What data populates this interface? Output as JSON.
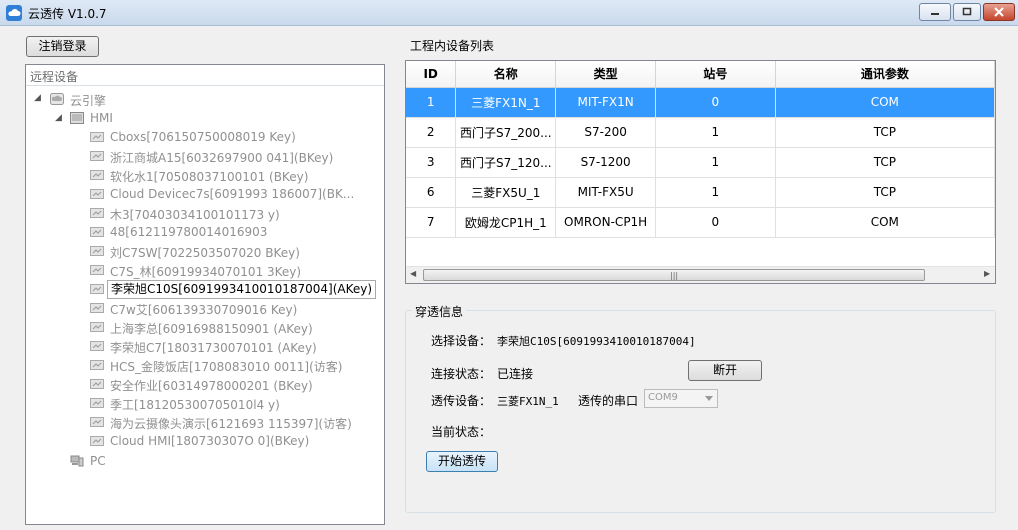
{
  "window": {
    "title": "云透传 V1.0.7"
  },
  "left": {
    "logout_label": "注销登录",
    "panel_header": "远程设备",
    "tree": {
      "root": "云引擎",
      "hmi": "HMI",
      "items": [
        "Cboxs[706150750008019          Key)",
        "浙江商城A15[6032697900         041](BKey)",
        "软化水1[70508037100101         (BKey)",
        "Cloud Devicec7s[6091993        186007](BK...",
        "木3[70403034100101173          y)",
        "48[612119780014016903",
        "刘C7SW[7022503507020           BKey)",
        "C7S_林[60919934070101          3Key)",
        "李荣旭C10S[6091993410010187004](AKey)",
        "C7w艾[606139330709016          Key)",
        "上海李总[60916988150901        (AKey)",
        "李荣旭C7[18031730070101        (AKey)",
        "HCS_金陵饭店[1708083010        0011](访客)",
        "安全作业[60314978000201        (BKey)",
        "季工[181205300705010l4         y)",
        "海为云摄像头演示[6121693       115397](访客)",
        "Cloud HMI[180730307O           0](BKey)"
      ],
      "selected_index": 8,
      "pc": "PC"
    }
  },
  "device_list": {
    "title": "工程内设备列表",
    "columns": [
      "ID",
      "名称",
      "类型",
      "站号",
      "通讯参数"
    ],
    "rows": [
      [
        "1",
        "三菱FX1N_1",
        "MIT-FX1N",
        "0",
        "COM"
      ],
      [
        "2",
        "西门子S7_200...",
        "S7-200",
        "1",
        "TCP"
      ],
      [
        "3",
        "西门子S7_120...",
        "S7-1200",
        "1",
        "TCP"
      ],
      [
        "6",
        "三菱FX5U_1",
        "MIT-FX5U",
        "1",
        "TCP"
      ],
      [
        "7",
        "欧姆龙CP1H_1",
        "OMRON-CP1H",
        "0",
        "COM"
      ]
    ],
    "selected_row": 0
  },
  "passthrough": {
    "group_title": "穿透信息",
    "select_device_label": "选择设备：",
    "select_device_value": "李荣旭C10S[6091993410010187004]",
    "conn_status_label": "连接状态：",
    "conn_status_value": "已连接",
    "disconnect_label": "断开",
    "pass_device_label": "透传设备：",
    "pass_device_value": "三菱FX1N_1",
    "serial_label": "透传的串口",
    "serial_value": "COM9",
    "current_status_label": "当前状态：",
    "start_label": "开始透传"
  }
}
